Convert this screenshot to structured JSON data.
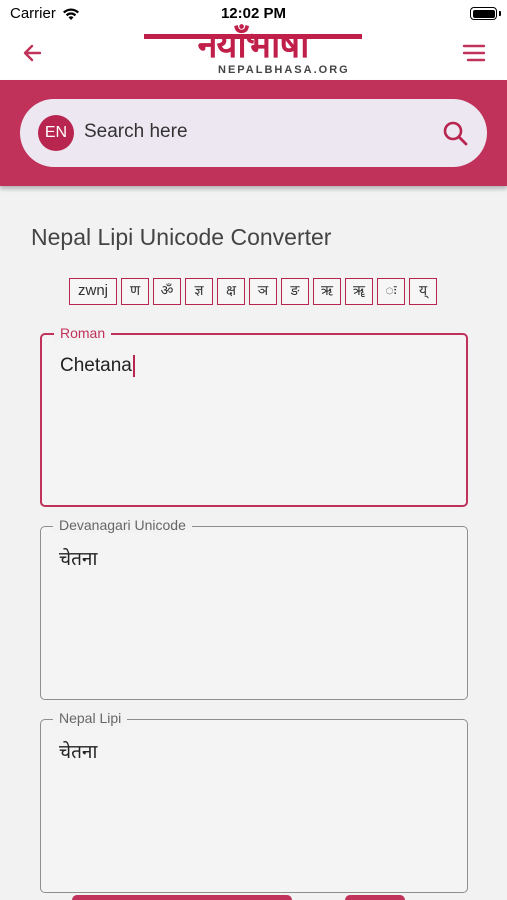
{
  "status_bar": {
    "carrier": "Carrier",
    "time": "12:02 PM"
  },
  "header": {
    "logo_text": "नयाँभाषा",
    "logo_subtitle": "NEPALBHASA.ORG",
    "accent_color": "#c0325a"
  },
  "search": {
    "language_badge": "EN",
    "placeholder": "Search here"
  },
  "page": {
    "title": "Nepal Lipi Unicode Converter"
  },
  "special_chars": [
    "zwnj",
    "ण",
    "ॐ",
    "ज्ञ",
    "क्ष",
    "ञ",
    "ङ",
    "ऋ",
    "ॠ",
    "ः",
    "य्"
  ],
  "fields": {
    "roman": {
      "label": "Roman",
      "value": "Chetana"
    },
    "devanagari": {
      "label": "Devanagari Unicode",
      "value": "चेतना"
    },
    "nepal_lipi": {
      "label": "Nepal Lipi",
      "value": "चेतना"
    }
  },
  "icons": {
    "back": "arrow-left-icon",
    "menu": "hamburger-menu-icon",
    "search": "search-icon",
    "wifi": "wifi-icon",
    "battery": "battery-icon"
  }
}
